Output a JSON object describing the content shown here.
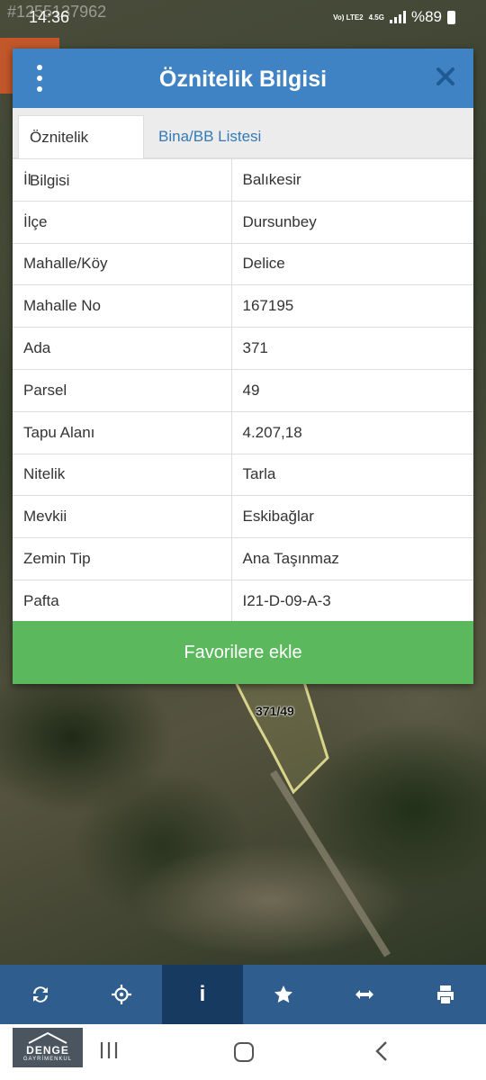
{
  "status_bar": {
    "time": "14:36",
    "watermark_id": "#1255137962",
    "network": "Vo) LTE2",
    "network_type": "4.5G",
    "battery": "%89"
  },
  "map": {
    "parcel_label": "371/49"
  },
  "dialog": {
    "title": "Öznitelik Bilgisi",
    "tabs": [
      {
        "label": "Öznitelik Bilgisi",
        "active": true
      },
      {
        "label": "Bina/BB Listesi",
        "active": false
      }
    ],
    "rows": [
      {
        "key": "İl",
        "value": "Balıkesir"
      },
      {
        "key": "İlçe",
        "value": "Dursunbey"
      },
      {
        "key": "Mahalle/Köy",
        "value": "Delice"
      },
      {
        "key": "Mahalle No",
        "value": "167195"
      },
      {
        "key": "Ada",
        "value": "371"
      },
      {
        "key": "Parsel",
        "value": "49"
      },
      {
        "key": "Tapu Alanı",
        "value": "4.207,18"
      },
      {
        "key": "Nitelik",
        "value": "Tarla"
      },
      {
        "key": "Mevkii",
        "value": "Eskibağlar"
      },
      {
        "key": "Zemin Tip",
        "value": "Ana Taşınmaz"
      },
      {
        "key": "Pafta",
        "value": "I21-D-09-A-3"
      }
    ],
    "favorite_button": "Favorilere ekle"
  },
  "toolbar": {
    "items": [
      {
        "icon": "refresh-icon",
        "active": false
      },
      {
        "icon": "locate-icon",
        "active": false
      },
      {
        "icon": "info-icon",
        "active": true,
        "glyph": "i"
      },
      {
        "icon": "star-icon",
        "active": false
      },
      {
        "icon": "measure-icon",
        "active": false
      },
      {
        "icon": "print-icon",
        "active": false
      }
    ]
  },
  "nav_logo": {
    "name": "DENGE",
    "sub": "GAYRİMENKUL"
  },
  "colors": {
    "header": "#3f83c4",
    "button": "#5cb85c",
    "toolbar": "#2f5e8e",
    "toolbar_active": "#173a61"
  }
}
